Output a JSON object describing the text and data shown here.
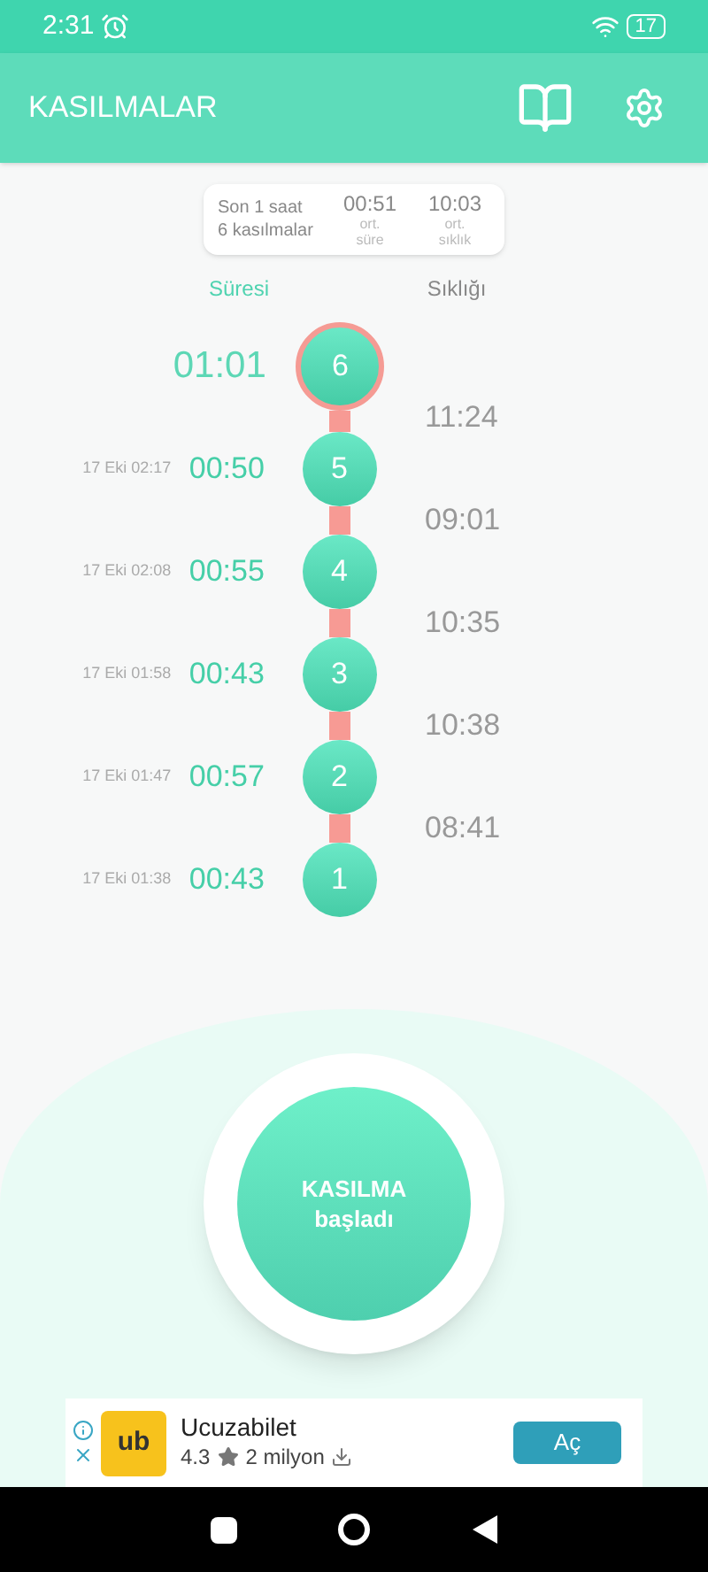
{
  "status_bar": {
    "time": "2:31",
    "battery": "17"
  },
  "app_bar": {
    "title": "KASILMALAR"
  },
  "summary": {
    "period": "Son 1 saat",
    "count": "6 kasılmalar",
    "avg_duration": "00:51",
    "avg_duration_label": "ort.\nsüre",
    "avg_frequency": "10:03",
    "avg_frequency_label": "ort.\nsıklık"
  },
  "tabs": [
    {
      "label": "Süresi",
      "selected": true
    },
    {
      "label": "Sıklığı",
      "selected": false
    }
  ],
  "contractions": [
    {
      "number": "6",
      "duration": "01:01",
      "current": true
    },
    {
      "number": "5",
      "date": "17 Eki 02:17",
      "duration": "00:50",
      "current": false
    },
    {
      "number": "4",
      "date": "17 Eki 02:08",
      "duration": "00:55",
      "current": false
    },
    {
      "number": "3",
      "date": "17 Eki 01:58",
      "duration": "00:43",
      "current": false
    },
    {
      "number": "2",
      "date": "17 Eki 01:47",
      "duration": "00:57",
      "current": false
    },
    {
      "number": "1",
      "date": "17 Eki 01:38",
      "duration": "00:43",
      "current": false
    }
  ],
  "frequencies": [
    "11:24",
    "09:01",
    "10:35",
    "10:38",
    "08:41"
  ],
  "start_button": {
    "line1": "KASILMA",
    "line2": "başladı"
  },
  "ad": {
    "logo_text": "ub",
    "title": "Ucuzabilet",
    "rating": "4.3",
    "downloads": "2 milyon",
    "button": "Aç"
  }
}
